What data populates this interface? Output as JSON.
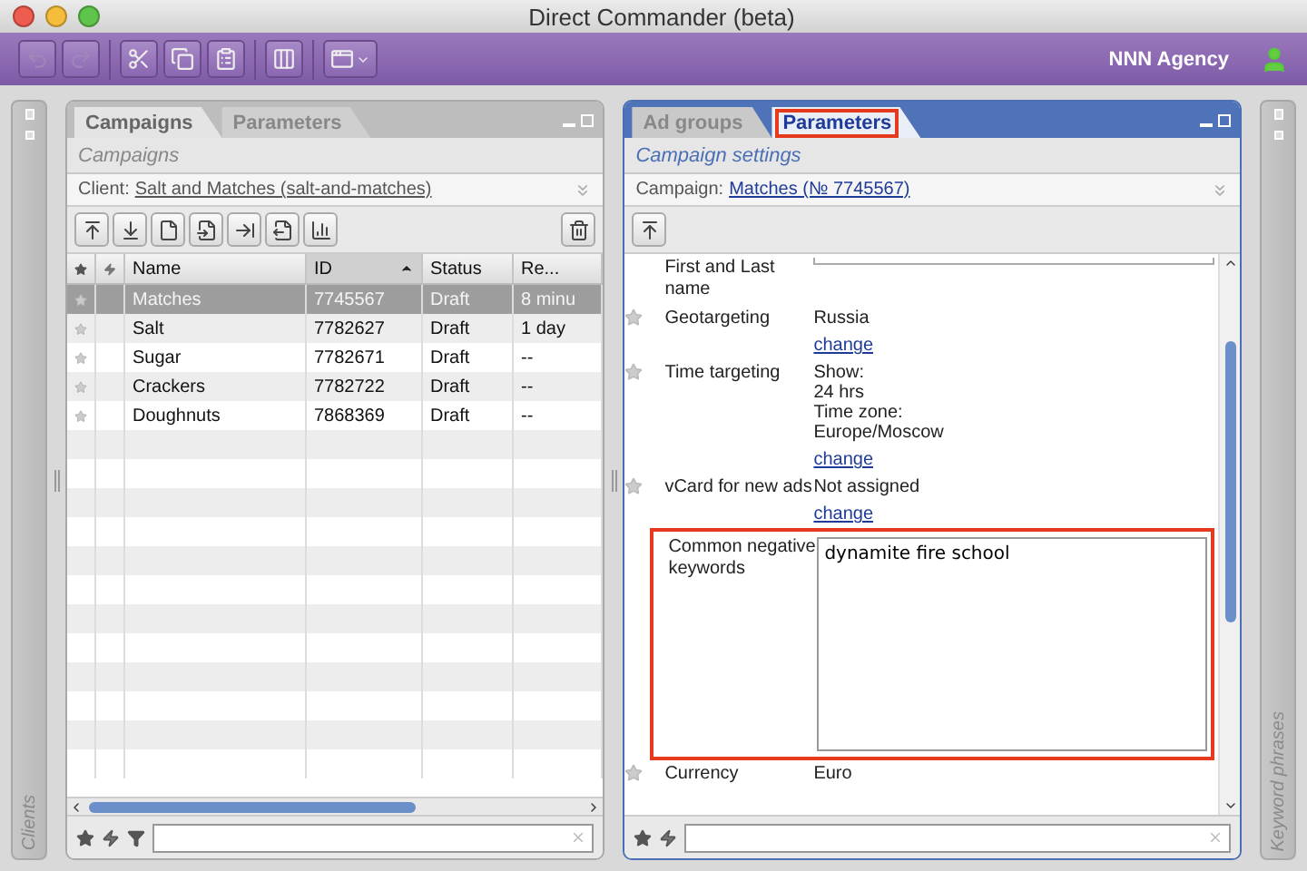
{
  "window": {
    "title": "Direct Commander (beta)"
  },
  "toolbar": {
    "buttons": [
      {
        "kind": "undo",
        "disabled": true
      },
      {
        "kind": "redo",
        "disabled": true
      },
      {
        "kind": "cut",
        "disabled": false
      },
      {
        "kind": "copy",
        "disabled": false
      },
      {
        "kind": "paste",
        "disabled": false
      },
      {
        "kind": "columns",
        "disabled": false
      },
      {
        "kind": "view",
        "disabled": false
      }
    ],
    "account": "NNN Agency"
  },
  "left_strip": {
    "label": "Clients"
  },
  "left_panel": {
    "tabs": [
      {
        "label": "Campaigns",
        "selected": true
      },
      {
        "label": "Parameters",
        "selected": false
      }
    ],
    "subtitle": "Campaigns",
    "context_label": "Client:",
    "context_link": "Salt and Matches (salt-and-matches)",
    "columns": [
      {
        "kind": "star"
      },
      {
        "kind": "bolt"
      },
      {
        "kind": "text",
        "label": "Name"
      },
      {
        "kind": "text",
        "label": "ID",
        "sorted": true
      },
      {
        "kind": "text",
        "label": "Status"
      },
      {
        "kind": "text",
        "label": "Re..."
      }
    ],
    "rows": [
      {
        "name": "Matches",
        "id": "7745567",
        "status": "Draft",
        "column_6": "8 minu",
        "selected": true
      },
      {
        "name": "Salt",
        "id": "7782627",
        "status": "Draft",
        "column_6": "1 day",
        "selected": false
      },
      {
        "name": "Sugar",
        "id": "7782671",
        "status": "Draft",
        "column_6": "--",
        "selected": false
      },
      {
        "name": "Crackers",
        "id": "7782722",
        "status": "Draft",
        "column_6": "--",
        "selected": false
      },
      {
        "name": "Doughnuts",
        "id": "7868369",
        "status": "Draft",
        "column_6": "--",
        "selected": false
      }
    ]
  },
  "right_panel": {
    "tabs": [
      {
        "label": "Ad groups",
        "selected": false,
        "highlighted": false
      },
      {
        "label": "Parameters",
        "selected": true,
        "highlighted": true
      }
    ],
    "subtitle": "Campaign settings",
    "context_label": "Campaign:",
    "context_link": "Matches (№ 7745567)",
    "fields": [
      {
        "kind": "cut",
        "label": "First and Last name",
        "highlighted": false
      },
      {
        "kind": "info",
        "label": "Geotargeting",
        "lines": [
          "Russia"
        ],
        "link": "change",
        "highlighted": false
      },
      {
        "kind": "info",
        "label": "Time targeting",
        "lines": [
          "Show:",
          "24 hrs",
          "Time zone:",
          "Europe/Moscow"
        ],
        "link": "change",
        "highlighted": false
      },
      {
        "kind": "info",
        "label": "vCard for new ads",
        "lines": [
          "Not assigned"
        ],
        "link": "change",
        "highlighted": false
      },
      {
        "kind": "textarea",
        "label": "Common negative keywords",
        "value": "dynamite fire school",
        "highlighted": true
      },
      {
        "kind": "info",
        "label": "Currency",
        "lines": [
          "Euro"
        ],
        "highlighted": false
      }
    ]
  },
  "right_strip": {
    "label": "Keyword phrases"
  }
}
